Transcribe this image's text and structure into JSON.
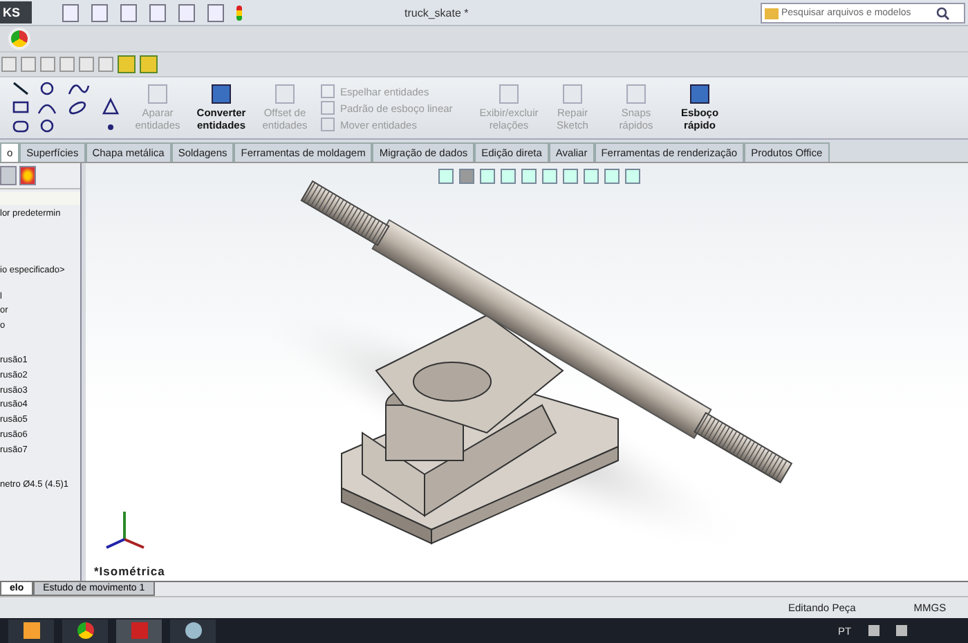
{
  "window": {
    "title": "truck_skate *",
    "app_name_fragment": "KS"
  },
  "search": {
    "placeholder": "Pesquisar arquivos e modelos"
  },
  "ribbon": {
    "commands": [
      {
        "label": "Aparar entidades",
        "kind": "large",
        "disabled": true
      },
      {
        "label": "Converter entidades",
        "kind": "large",
        "disabled": false
      },
      {
        "label": "Offset de entidades",
        "kind": "large",
        "disabled": true
      },
      {
        "label": "Espelhar entidades",
        "kind": "small",
        "disabled": true
      },
      {
        "label": "Padrão de esboço linear",
        "kind": "small",
        "disabled": true
      },
      {
        "label": "Mover entidades",
        "kind": "small",
        "disabled": true
      },
      {
        "label": "Exibir/excluir relações",
        "kind": "large",
        "disabled": true
      },
      {
        "label": "Repair Sketch",
        "kind": "large",
        "disabled": true
      },
      {
        "label": "Snaps rápidos",
        "kind": "large",
        "disabled": true
      },
      {
        "label": "Esboço rápido",
        "kind": "large",
        "disabled": false
      }
    ]
  },
  "command_tabs": [
    {
      "label": "o",
      "selected": true
    },
    {
      "label": "Superfícies",
      "selected": false
    },
    {
      "label": "Chapa metálica",
      "selected": false
    },
    {
      "label": "Soldagens",
      "selected": false
    },
    {
      "label": "Ferramentas de moldagem",
      "selected": false
    },
    {
      "label": "Migração de dados",
      "selected": false
    },
    {
      "label": "Edição direta",
      "selected": false
    },
    {
      "label": "Avaliar",
      "selected": false
    },
    {
      "label": "Ferramentas de renderização",
      "selected": false
    },
    {
      "label": "Produtos Office",
      "selected": false
    }
  ],
  "feature_tree": {
    "items": [
      "lor predetermin",
      "io especificado>",
      "l",
      "or",
      "o",
      "rusão1",
      "rusão2",
      "rusão3",
      "rusão4",
      "rusão5",
      "rusão6",
      "rusão7",
      "netro Ø4.5 (4.5)1"
    ]
  },
  "viewport": {
    "view_label": "*Isométrica"
  },
  "bottom_tabs": [
    {
      "label": "elo",
      "selected": true
    },
    {
      "label": "Estudo de movimento 1",
      "selected": false
    }
  ],
  "status_bar": {
    "mode": "Editando Peça",
    "units": "MMGS"
  },
  "taskbar": {
    "language": "PT"
  }
}
